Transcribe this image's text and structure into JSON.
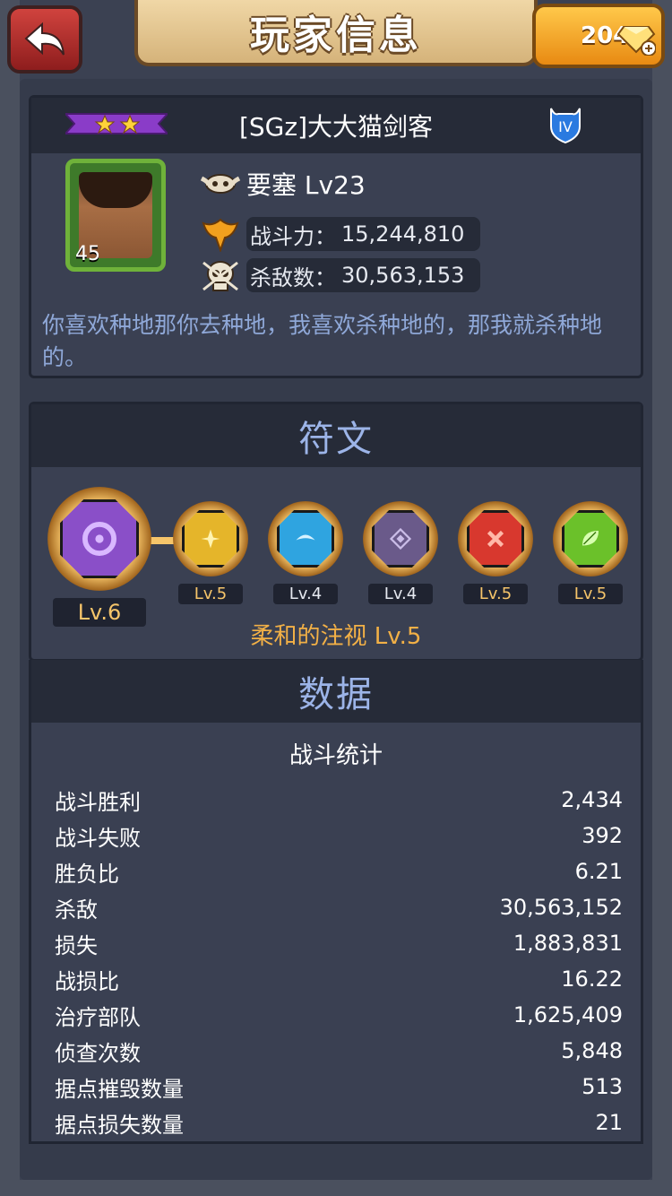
{
  "header": {
    "title": "玩家信息",
    "gems": "204"
  },
  "profile": {
    "name": "[SGz]大大猫剑客",
    "stars": 2,
    "tier": "IV",
    "portrait_level": "45",
    "fortress": "要塞 Lv23",
    "power_label": "战斗力：",
    "power_value": "15,244,810",
    "kills_label": "杀敌数：",
    "kills_value": "30,563,153",
    "motto": "你喜欢种地那你去种地，我喜欢杀种地的，那我就杀种地的。"
  },
  "runes": {
    "title": "符文",
    "items": [
      {
        "level": "Lv.6",
        "color": "#8a4fc8",
        "icon": "crescent-icon"
      },
      {
        "level": "Lv.5",
        "color": "#e5b52a",
        "icon": "sparkle-icon"
      },
      {
        "level": "Lv.4",
        "color": "#2fa4e0",
        "icon": "wave-icon"
      },
      {
        "level": "Lv.4",
        "color": "#6a5a8a",
        "icon": "diamond-icon"
      },
      {
        "level": "Lv.5",
        "color": "#d8382e",
        "icon": "cross-icon"
      },
      {
        "level": "Lv.5",
        "color": "#6bc12a",
        "icon": "leaf-icon"
      }
    ],
    "selected_caption": "柔和的注视 Lv.5"
  },
  "data": {
    "title": "数据",
    "subtitle": "战斗统计",
    "rows": [
      {
        "label": "战斗胜利",
        "value": "2,434"
      },
      {
        "label": "战斗失败",
        "value": "392"
      },
      {
        "label": "胜负比",
        "value": "6.21"
      },
      {
        "label": "杀敌",
        "value": "30,563,152"
      },
      {
        "label": "损失",
        "value": "1,883,831"
      },
      {
        "label": "战损比",
        "value": "16.22"
      },
      {
        "label": "治疗部队",
        "value": "1,625,409"
      },
      {
        "label": "侦查次数",
        "value": "5,848"
      },
      {
        "label": "据点摧毁数量",
        "value": "513"
      },
      {
        "label": "据点损失数量",
        "value": "21"
      }
    ]
  }
}
